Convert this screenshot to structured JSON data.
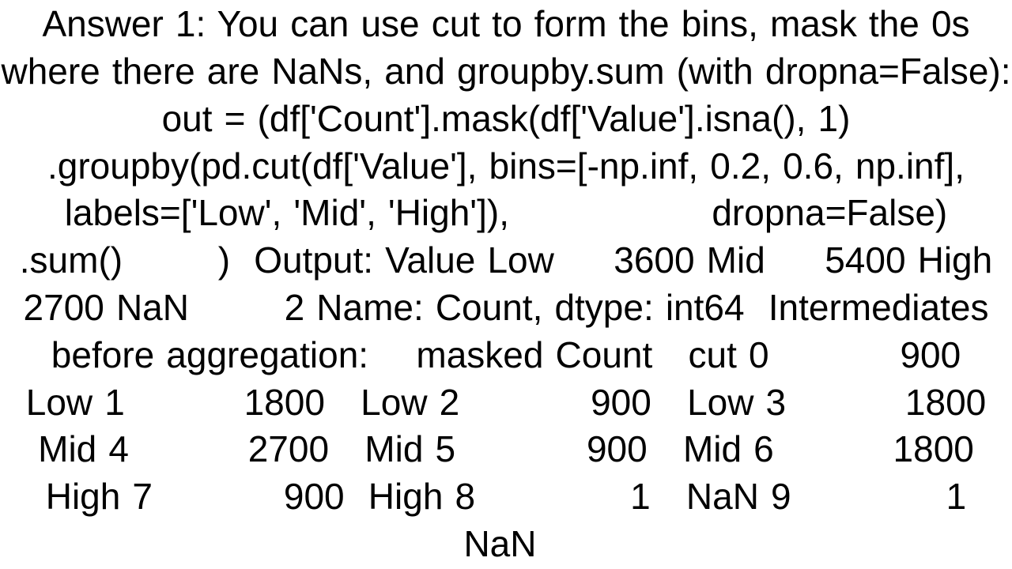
{
  "text": "Answer 1: You can use cut to form the bins, mask the 0s where there are NaNs, and groupby.sum (with dropna=False): out = (df['Count'].mask(df['Value'].isna(), 1)        .groupby(pd.cut(df['Value'], bins=[-np.inf, 0.2, 0.6, np.inf],                        labels=['Low', 'Mid', 'High']),                 dropna=False)        .sum()        )  Output: Value Low     3600 Mid     5400 High    2700 NaN        2 Name: Count, dtype: int64  Intermediates before aggregation:    masked Count   cut 0           900   Low 1          1800   Low 2           900   Low 3          1800   Mid 4          2700   Mid 5           900   Mid 6          1800  High 7           900  High 8             1   NaN 9             1   NaN "
}
